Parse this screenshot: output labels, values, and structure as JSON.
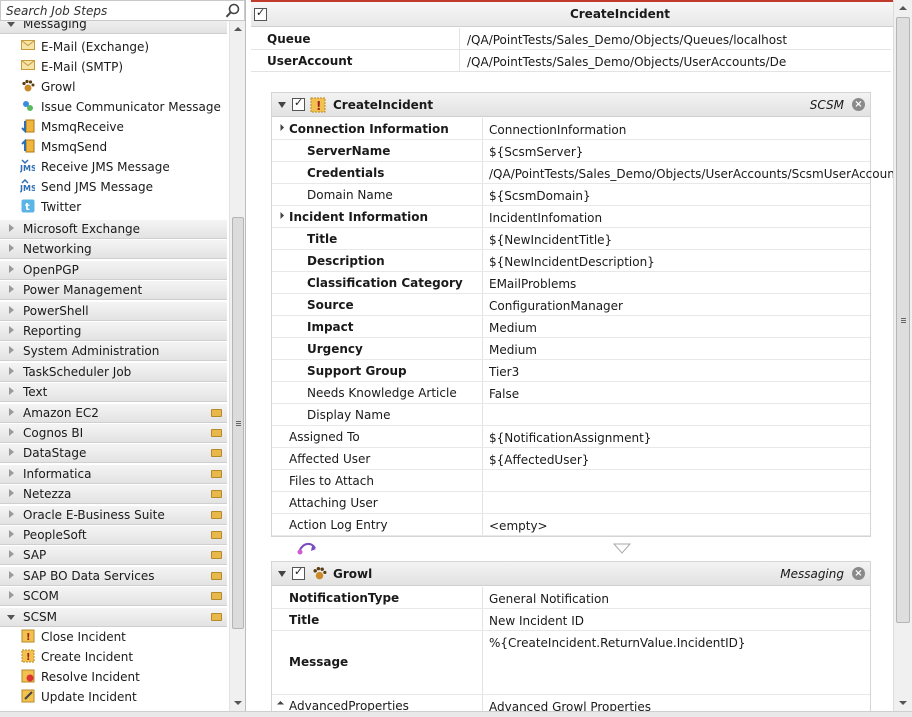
{
  "search": {
    "placeholder": "Search Job Steps"
  },
  "tree": {
    "open_group": "Messaging",
    "messaging_items": [
      {
        "label": "E-Mail (Exchange)",
        "icon": "envelope-icon"
      },
      {
        "label": "E-Mail (SMTP)",
        "icon": "envelope-icon"
      },
      {
        "label": "Growl",
        "icon": "growl-paw-icon"
      },
      {
        "label": "Issue Communicator Message",
        "icon": "communicator-icon"
      },
      {
        "label": "MsmqReceive",
        "icon": "msmq-receive-icon"
      },
      {
        "label": "MsmqSend",
        "icon": "msmq-send-icon"
      },
      {
        "label": "Receive JMS Message",
        "icon": "jms-receive-icon"
      },
      {
        "label": "Send JMS Message",
        "icon": "jms-send-icon"
      },
      {
        "label": "Twitter",
        "icon": "twitter-icon"
      }
    ],
    "groups": [
      "Microsoft Exchange",
      "Networking",
      "OpenPGP",
      "Power Management",
      "PowerShell",
      "Reporting",
      "System Administration",
      "TaskScheduler Job",
      "Text",
      "Amazon EC2",
      "Cognos BI",
      "DataStage",
      "Informatica",
      "Netezza",
      "Oracle E-Business Suite",
      "PeopleSoft",
      "SAP",
      "SAP BO Data Services",
      "SCOM",
      "SCSM"
    ],
    "scsm_items": [
      {
        "label": "Close Incident",
        "icon": "close-incident-icon"
      },
      {
        "label": "Create Incident",
        "icon": "create-incident-icon"
      },
      {
        "label": "Resolve Incident",
        "icon": "resolve-incident-icon"
      },
      {
        "label": "Update Incident",
        "icon": "update-incident-icon"
      }
    ]
  },
  "job": {
    "title": "CreateIncident",
    "props": [
      {
        "key": "Queue",
        "value": "/QA/PointTests/Sales_Demo/Objects/Queues/localhost"
      },
      {
        "key": "UserAccount",
        "value": "/QA/PointTests/Sales_Demo/Objects/UserAccounts/Demo"
      }
    ]
  },
  "step1": {
    "name": "CreateIncident",
    "category": "SCSM",
    "rows": [
      {
        "key": "Connection Information",
        "value": "ConnectionInformation"
      },
      {
        "key": "ServerName",
        "value": "${ScsmServer}"
      },
      {
        "key": "Credentials",
        "value": "/QA/PointTests/Sales_Demo/Objects/UserAccounts/ScsmUserAccount"
      },
      {
        "key": "Domain Name",
        "value": "${ScsmDomain}"
      },
      {
        "key": "Incident Information",
        "value": "IncidentInfomation"
      },
      {
        "key": "Title",
        "value": "${NewIncidentTitle}"
      },
      {
        "key": "Description",
        "value": "${NewIncidentDescription}"
      },
      {
        "key": "Classification Category",
        "value": "EMailProblems"
      },
      {
        "key": "Source",
        "value": "ConfigurationManager"
      },
      {
        "key": "Impact",
        "value": "Medium"
      },
      {
        "key": "Urgency",
        "value": "Medium"
      },
      {
        "key": "Support Group",
        "value": "Tier3"
      },
      {
        "key": "Needs Knowledge Article",
        "value": "False"
      },
      {
        "key": "Display Name",
        "value": ""
      },
      {
        "key": "Assigned To",
        "value": "${NotificationAssignment}"
      },
      {
        "key": "Affected User",
        "value": "${AffectedUser}"
      },
      {
        "key": "Files to Attach",
        "value": ""
      },
      {
        "key": "Attaching User",
        "value": ""
      },
      {
        "key": "Action Log Entry",
        "value": "<empty>"
      }
    ]
  },
  "step2": {
    "name": "Growl",
    "category": "Messaging",
    "rows": [
      {
        "key": "NotificationType",
        "value": "General Notification"
      },
      {
        "key": "Title",
        "value": "New Incident ID"
      },
      {
        "key": "Message",
        "value": "%{CreateIncident.ReturnValue.IncidentID}"
      },
      {
        "key": "AdvancedProperties",
        "value": "Advanced Growl Properties"
      }
    ]
  },
  "colors": {
    "accent_red": "#c0392b",
    "folder": "#e8b84a"
  }
}
